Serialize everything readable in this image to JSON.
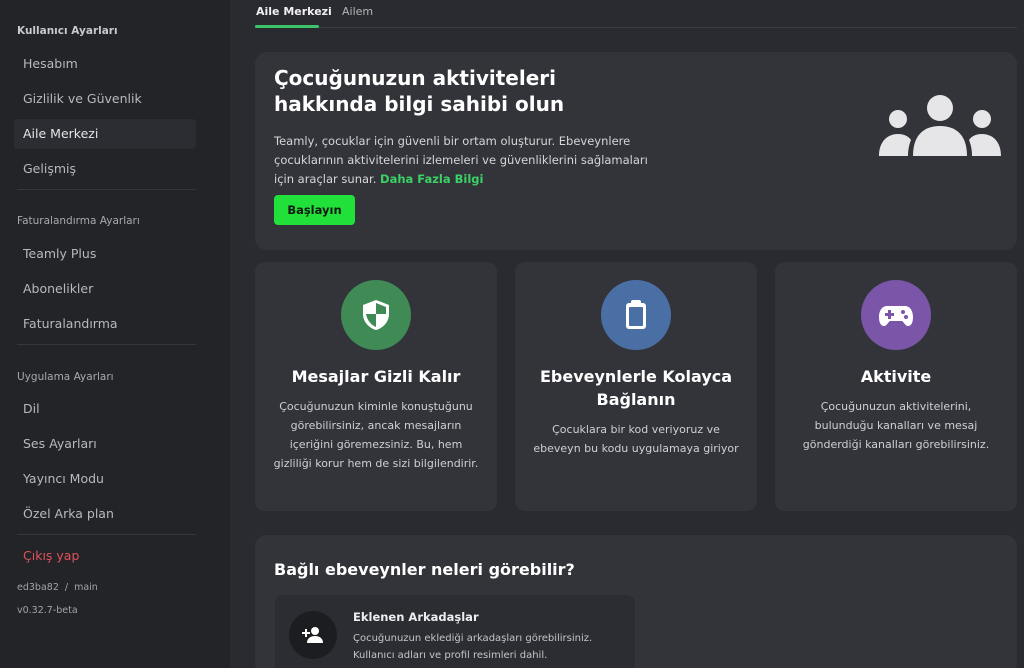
{
  "sidebar": {
    "sections": [
      {
        "title": "Kullanıcı Ayarları",
        "items": [
          "Hesabım",
          "Gizlilik ve Güvenlik",
          "Aile Merkezi",
          "Gelişmiş"
        ]
      },
      {
        "title": "Faturalandırma Ayarları",
        "items": [
          "Teamly Plus",
          "Abonelikler",
          "Faturalandırma"
        ]
      },
      {
        "title": "Uygulama Ayarları",
        "items": [
          "Dil",
          "Ses Ayarları",
          "Yayıncı Modu",
          "Özel Arka plan"
        ]
      }
    ],
    "active_item": "Aile Merkezi",
    "logout_label": "Çıkış yap",
    "build_hash": "ed3ba82",
    "build_branch": "main",
    "build_separator": "/",
    "version": "v0.32.7-beta"
  },
  "tabs": [
    {
      "label": "Aile Merkezi",
      "active": true
    },
    {
      "label": "Ailem",
      "active": false
    }
  ],
  "hero": {
    "title": "Çocuğunuzun aktiviteleri hakkında bilgi sahibi olun",
    "description": "Teamly, çocuklar için güvenli bir ortam oluşturur. Ebeveynlere çocuklarının aktivitelerini izlemeleri ve güvenliklerini sağlamaları için araçlar sunar.",
    "link_label": "Daha Fazla Bilgi",
    "button_label": "Başlayın",
    "icon": "family-group-icon"
  },
  "features": [
    {
      "icon": "shield-icon",
      "color": "#3f8a55",
      "title": "Mesajlar Gizli Kalır",
      "description": "Çocuğunuzun kiminle konuştuğunu görebilirsiniz, ancak mesajların içeriğini göremezsiniz. Bu, hem gizliliği korur hem de sizi bilgilendirir."
    },
    {
      "icon": "clipboard-icon",
      "color": "#4a6fa5",
      "title": "Ebeveynlerle Kolayca Bağlanın",
      "description": "Çocuklara bir kod veriyoruz ve ebeveyn bu kodu uygulamaya giriyor"
    },
    {
      "icon": "gamepad-icon",
      "color": "#7a55a8",
      "title": "Aktivite",
      "description": "Çocuğunuzun aktivitelerini, bulunduğu kanalları ve mesaj gönderdiği kanalları görebilirsiniz."
    }
  ],
  "bottom": {
    "title": "Bağlı ebeveynler neleri görebilir?",
    "items": [
      {
        "icon": "add-friend-icon",
        "title": "Eklenen Arkadaşlar",
        "description": "Çocuğunuzun eklediği arkadaşları görebilirsiniz. Kullanıcı adları ve profil resimleri dahil."
      }
    ]
  },
  "colors": {
    "accent": "#22e03a",
    "link": "#3bd165",
    "logout": "#e0525b",
    "background": "#2a2b30",
    "sidebar": "#232428",
    "card": "#33343a"
  }
}
